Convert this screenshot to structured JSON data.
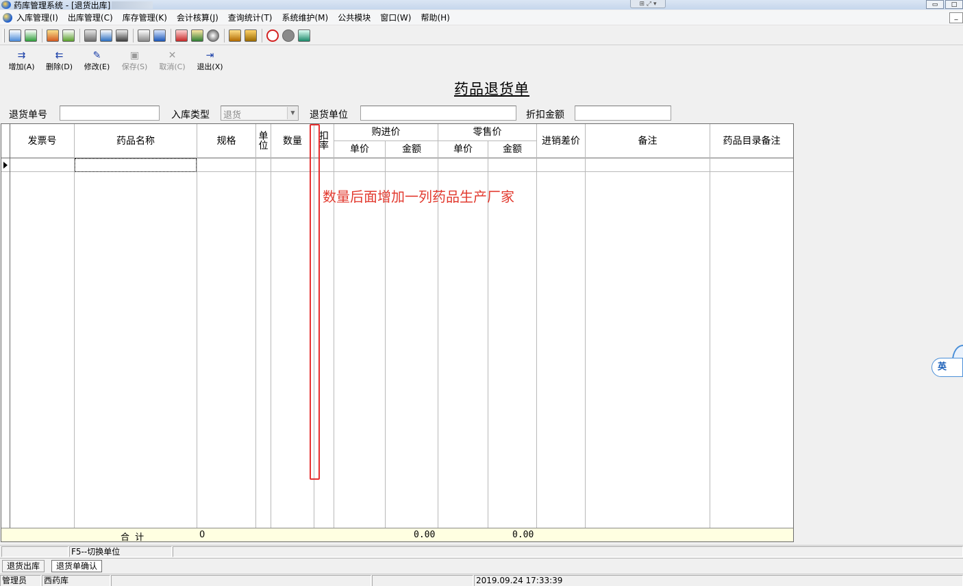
{
  "window": {
    "title": "药库管理系统 - [退货出库]",
    "mdi_restore": "_"
  },
  "menu": {
    "items": [
      "入库管理(I)",
      "出库管理(C)",
      "库存管理(K)",
      "会计核算(J)",
      "查询统计(T)",
      "系统维护(M)",
      "公共模块",
      "窗口(W)",
      "帮助(H)"
    ]
  },
  "toolbar": {
    "icons": [
      "open-icon",
      "export-icon",
      "report-icon",
      "check-icon",
      "clipboard-icon",
      "chart-icon",
      "calculator-icon",
      "stock-icon",
      "document-icon",
      "grid-icon",
      "calendar-icon",
      "tools-icon",
      "search-icon",
      "vehicle-icon",
      "thermometer-icon",
      "stop-icon",
      "disk-icon",
      "exit-icon"
    ]
  },
  "actions": {
    "add": "增加(A)",
    "delete": "删除(D)",
    "edit": "修改(E)",
    "save": "保存(S)",
    "cancel": "取消(C)",
    "exit": "退出(X)"
  },
  "form": {
    "title": "药品退货单",
    "return_no_label": "退货单号",
    "return_no_value": "",
    "in_type_label": "入库类型",
    "in_type_value": "退货",
    "return_unit_label": "退货单位",
    "return_unit_value": "",
    "discount_label": "折扣金额",
    "discount_value": ""
  },
  "grid": {
    "columns": {
      "invoice_no": "发票号",
      "drug_name": "药品名称",
      "spec": "规格",
      "unit": "单位",
      "quantity": "数量",
      "discount_rate": "扣率",
      "purchase": "购进价",
      "purchase_unit_price": "单价",
      "purchase_amount": "金额",
      "retail": "零售价",
      "retail_unit_price": "单价",
      "retail_amount": "金额",
      "price_diff": "进销差价",
      "remark": "备注",
      "catalog_remark": "药品目录备注"
    },
    "total_row": {
      "label": "合  计",
      "spec_value": "0",
      "purchase_amount": "0.00",
      "retail_amount": "0.00"
    }
  },
  "annotation": {
    "text": "数量后面增加一列药品生产厂家",
    "color": "#e23a2f"
  },
  "status": {
    "hint": "F5--切换单位",
    "tabs": [
      "退货出库",
      "退货单确认"
    ],
    "user": "管理员",
    "warehouse": "西药库",
    "datetime": "2019.09.24 17:33:39"
  },
  "ime": {
    "label": "英"
  }
}
